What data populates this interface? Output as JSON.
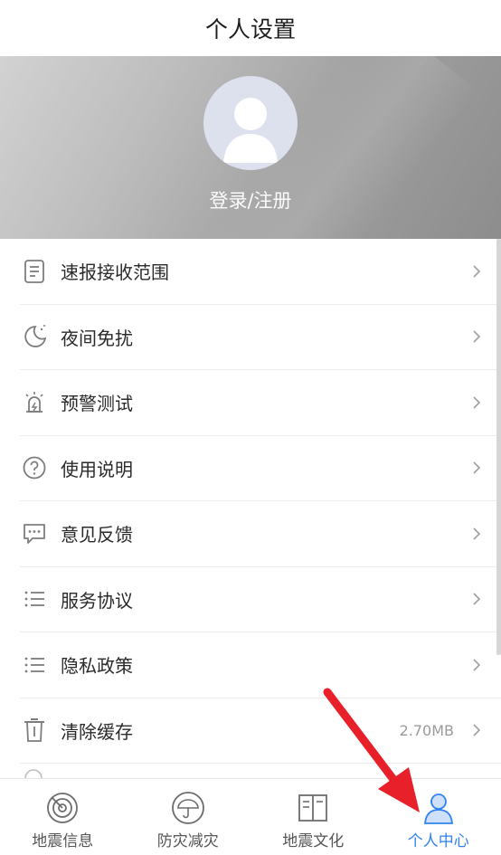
{
  "header": {
    "title": "个人设置"
  },
  "profile": {
    "login_label": "登录/注册"
  },
  "menu": [
    {
      "label": "速报接收范围",
      "icon": "document-icon",
      "value": ""
    },
    {
      "label": "夜间免扰",
      "icon": "moon-icon",
      "value": ""
    },
    {
      "label": "预警测试",
      "icon": "alarm-icon",
      "value": ""
    },
    {
      "label": "使用说明",
      "icon": "question-icon",
      "value": ""
    },
    {
      "label": "意见反馈",
      "icon": "feedback-icon",
      "value": ""
    },
    {
      "label": "服务协议",
      "icon": "list-icon",
      "value": ""
    },
    {
      "label": "隐私政策",
      "icon": "list-icon",
      "value": ""
    },
    {
      "label": "清除缓存",
      "icon": "trash-icon",
      "value": "2.70MB"
    }
  ],
  "tabs": [
    {
      "label": "地震信息",
      "icon": "radar-icon",
      "active": false
    },
    {
      "label": "防灾减灾",
      "icon": "umbrella-icon",
      "active": false
    },
    {
      "label": "地震文化",
      "icon": "book-icon",
      "active": false
    },
    {
      "label": "个人中心",
      "icon": "person-icon",
      "active": true
    }
  ],
  "colors": {
    "accent": "#2f82f0",
    "annotation_arrow": "#e8202a"
  }
}
